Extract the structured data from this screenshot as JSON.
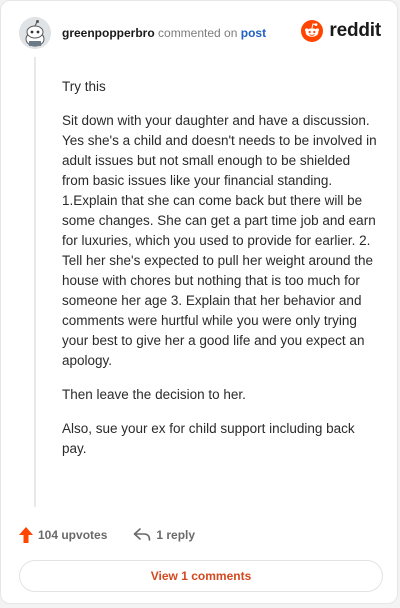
{
  "header": {
    "username": "greenpopperbro",
    "commented_on": "commented on",
    "post_link": "post",
    "brand": "reddit"
  },
  "comment": {
    "paragraphs": [
      "Try this",
      "Sit down with your daughter and have a discussion. Yes she's a child and doesn't needs to be involved in adult issues but not small enough to be shielded from basic issues like your financial standing. 1.Explain that she can come back but there will be some changes. She can get a part time job and earn for luxuries, which you used to provide for earlier. 2. Tell her she's expected to pull her weight around the house with chores but nothing that is too much for someone her age 3. Explain that her behavior and comments were hurtful while you were only trying your best to give her a good life and you expect an apology.",
      "Then leave the decision to her.",
      "Also, sue your ex for child support including back pay."
    ]
  },
  "actions": {
    "upvotes": "104 upvotes",
    "replies": "1 reply"
  },
  "footer": {
    "view_comments": "View 1 comments"
  },
  "colors": {
    "reddit_orange": "#ff4500",
    "upvote": "#ff4500",
    "link": "#1f5fbf",
    "view_comments_text": "#d2491f"
  },
  "icons": {
    "avatar": "snoo-avatar-icon",
    "brand": "reddit-logo-icon",
    "upvote": "upvote-arrow-icon",
    "reply": "reply-arrow-icon"
  }
}
